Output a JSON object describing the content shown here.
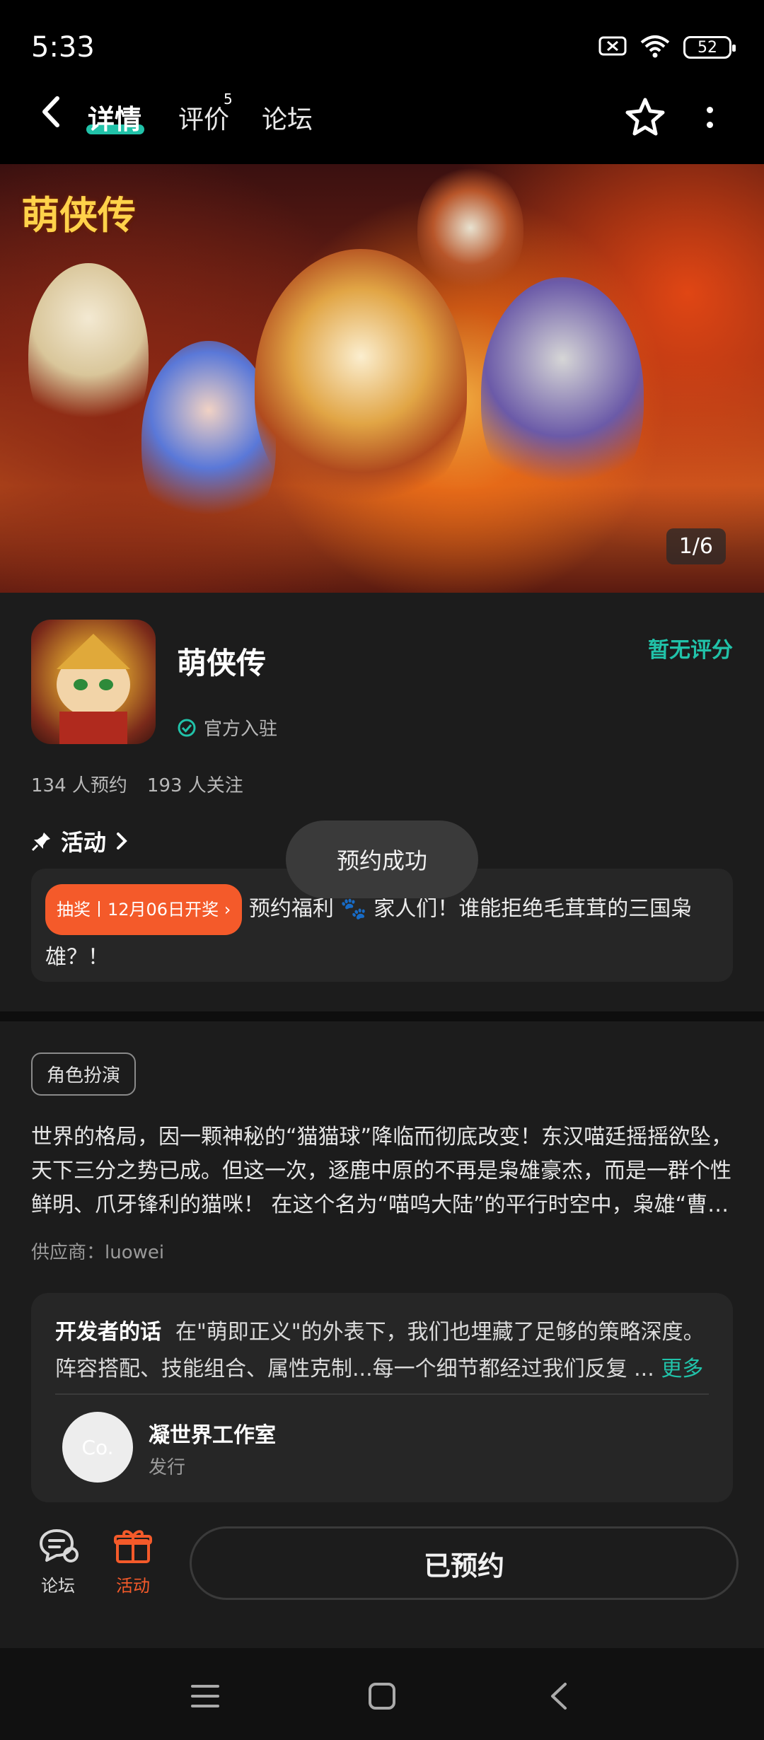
{
  "status_bar": {
    "time": "5:33",
    "battery": "52"
  },
  "nav": {
    "tabs": [
      {
        "label": "详情",
        "active": true
      },
      {
        "label": "评价",
        "badge": "5"
      },
      {
        "label": "论坛"
      }
    ]
  },
  "banner": {
    "logo_text": "萌侠传",
    "counter": "1/6"
  },
  "app": {
    "name": "萌侠传",
    "official_label": "官方入驻",
    "rating_text": "暂无评分",
    "reservations": "134 人预约",
    "followers": "193 人关注"
  },
  "activity": {
    "heading": "活动",
    "tag": "抽奖丨12月06日开奖",
    "text": "预约福利 🐾 家人们！谁能拒绝毛茸茸的三国枭雄？！"
  },
  "toast": "预约成功",
  "genre": "角色扮演",
  "description": "世界的格局，因一颗神秘的“猫猫球”降临而彻底改变！东汉喵廷摇摇欲坠，天下三分之势已成。但这一次，逐鹿中原的不再是枭雄豪杰，而是一群个性鲜明、爪牙锋利的猫咪！ 在这个名为“喵呜大陆”的平行时空中，枭雄“曹…",
  "provider": "供应商：luowei",
  "developer": {
    "say_label": "开发者的话",
    "say_text": "在\"萌即正义\"的外表下，我们也埋藏了足够的策略深度。阵容搭配、技能组合、属性克制...每一个细节都经过我们反复 ...",
    "more_label": "更多",
    "avatar_text": "Co.",
    "studio_name": "凝世界工作室",
    "studio_role": "发行"
  },
  "bottom_bar": {
    "forum_label": "论坛",
    "activity_label": "活动",
    "main_button": "已预约"
  },
  "colors": {
    "accent": "#21c2a9",
    "orange": "#f45a2a",
    "background": "#1c1c1c"
  }
}
